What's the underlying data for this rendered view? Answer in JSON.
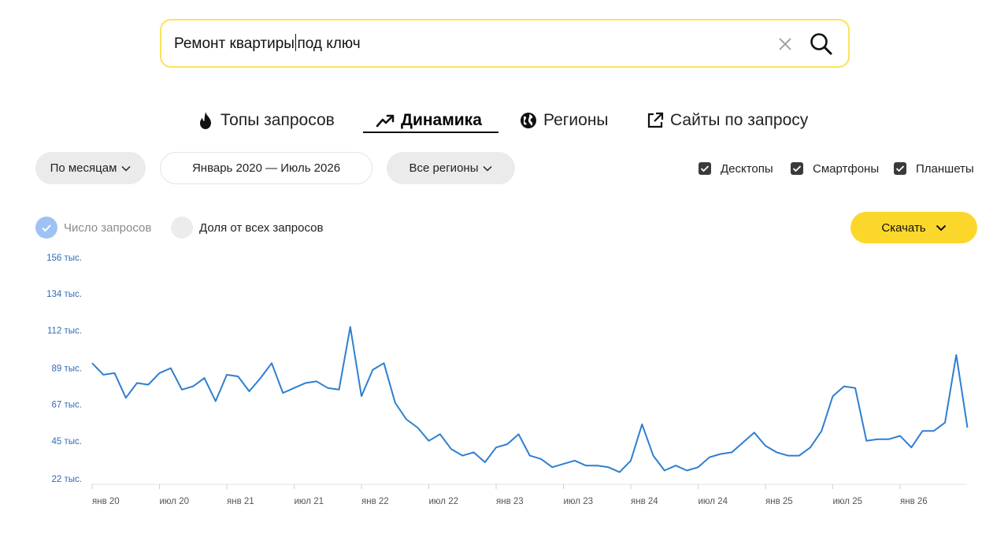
{
  "search": {
    "query_before": "Ремонт квартиры",
    "query_after": "под ключ"
  },
  "tabs": [
    "Топы запросов",
    "Динамика",
    "Регионы",
    "Сайты по запросу"
  ],
  "filters": {
    "period_group": "По месяцам",
    "date_range": "Январь 2020 — Июль 2026",
    "region": "Все регионы"
  },
  "devices": [
    "Десктопы",
    "Смартфоны",
    "Планшеты"
  ],
  "metrics": {
    "count_label": "Число запросов",
    "share_label": "Доля от всех запросов"
  },
  "download_label": "Скачать",
  "colors": {
    "accent": "#fcd72b",
    "line": "#2e7fd0",
    "search_border": "#fde15b"
  },
  "chart_data": {
    "type": "line",
    "ytick_labels": [
      "22 тыс.",
      "45 тыс.",
      "67 тыс.",
      "89 тыс.",
      "112 тыс.",
      "134 тыс.",
      "156 тыс."
    ],
    "ytick_values": [
      22,
      45,
      67,
      89,
      112,
      134,
      156
    ],
    "ylim": [
      22,
      156
    ],
    "xtick_labels": [
      "янв 20",
      "июл 20",
      "янв 21",
      "июл 21",
      "янв 22",
      "июл 22",
      "янв 23",
      "июл 23",
      "янв 24",
      "июл 24",
      "янв 25",
      "июл 25",
      "янв 26"
    ],
    "series": [
      {
        "values": [
          92,
          85,
          86,
          71,
          80,
          79,
          86,
          89,
          76,
          78,
          83,
          69,
          85,
          84,
          75,
          83,
          92,
          74,
          77,
          80,
          81,
          77,
          76,
          114,
          72,
          88,
          92,
          68,
          58,
          53,
          45,
          49,
          40,
          36,
          38,
          32,
          41,
          43,
          49,
          36,
          34,
          29,
          31,
          33,
          30,
          30,
          29,
          26,
          33,
          55,
          36,
          27,
          30,
          27,
          29,
          35,
          37,
          38,
          44,
          50,
          42,
          38,
          36,
          36,
          41,
          51,
          72,
          78,
          77,
          45,
          46,
          46,
          48,
          41,
          51,
          51,
          56,
          97,
          53
        ]
      }
    ]
  }
}
